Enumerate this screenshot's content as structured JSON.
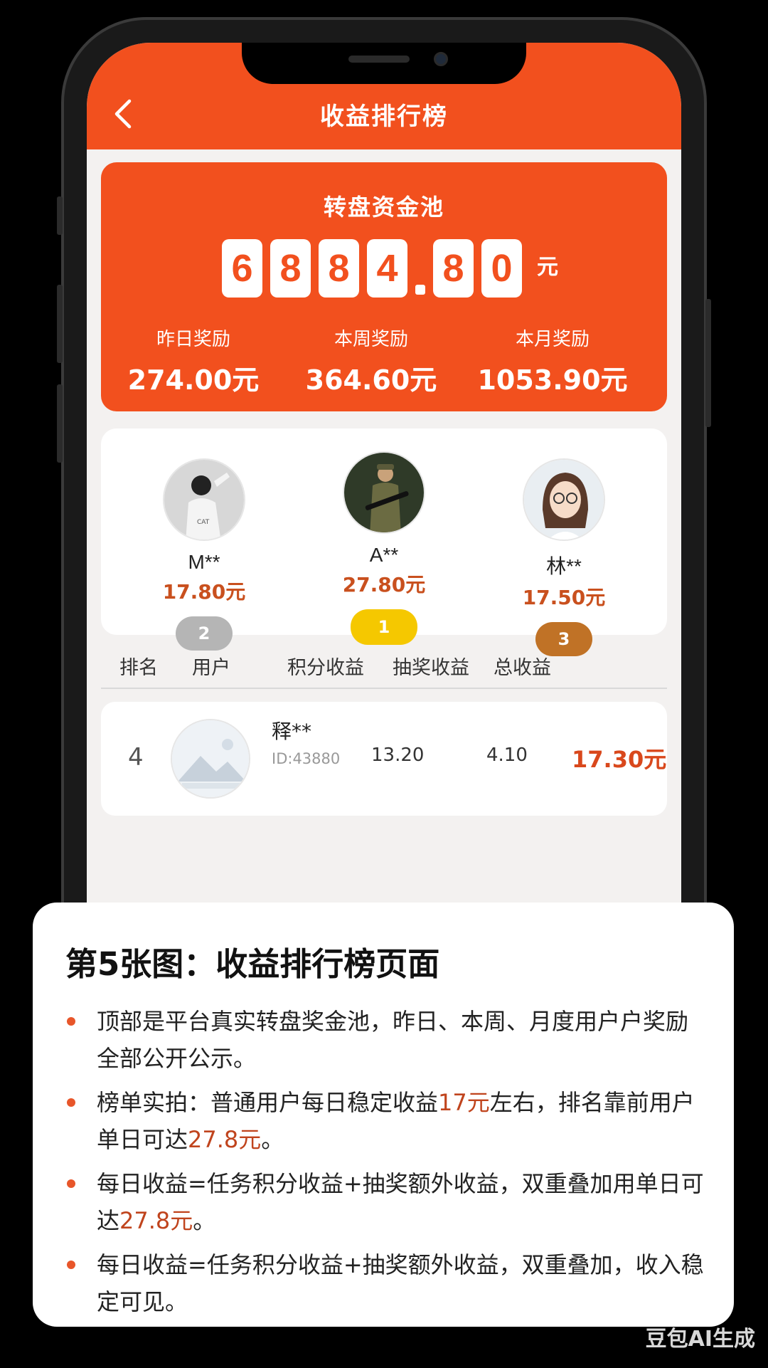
{
  "header": {
    "title": "收益排行榜",
    "back_icon": "chevron-left-icon"
  },
  "pool": {
    "title": "转盘资金池",
    "digits": [
      "6",
      "8",
      "8",
      "4",
      "8",
      "0"
    ],
    "unit": "元",
    "stats": [
      {
        "label": "昨日奖励",
        "value": "274.00元"
      },
      {
        "label": "本周奖励",
        "value": "364.60元"
      },
      {
        "label": "本月奖励",
        "value": "1053.90元"
      }
    ]
  },
  "podium": [
    {
      "name": "M**",
      "amount": "17.80元",
      "rank": "2",
      "pill_color": "#b5b5b5"
    },
    {
      "name": "A**",
      "amount": "27.80元",
      "rank": "1",
      "pill_color": "#f5c800"
    },
    {
      "name": "林**",
      "amount": "17.50元",
      "rank": "3",
      "pill_color": "#c07226"
    }
  ],
  "table": {
    "headers": [
      "排名",
      "用户",
      "积分收益",
      "抽奖收益",
      "总收益"
    ],
    "rows": [
      {
        "rank": "4",
        "name": "释**",
        "id": "ID:43880",
        "points": "13.20",
        "lottery": "4.10",
        "total": "17.30元"
      }
    ]
  },
  "note": {
    "title": "第5张图：收益排行榜页面",
    "bullets": [
      {
        "parts": [
          "顶部是平台真实转盘奖金池，昨日、本周、月度用户户奖励全部公开公示。"
        ]
      },
      {
        "parts": [
          "榜单实拍：普通用户每日稳定收益",
          "17元",
          "左右，排名靠前用户单日可达",
          "27.8元",
          "。"
        ]
      },
      {
        "parts": [
          "每日收益=任务积分收益+抽奖额外收益，双重叠加用单日可达",
          "27.8元",
          "。"
        ]
      },
      {
        "parts": [
          "每日收益=任务积分收益+抽奖额外收益，双重叠加，收入稳定可见。"
        ]
      }
    ]
  },
  "watermark": "豆包AI生成",
  "colors": {
    "accent": "#f2501e",
    "highlight": "#c0441d"
  }
}
